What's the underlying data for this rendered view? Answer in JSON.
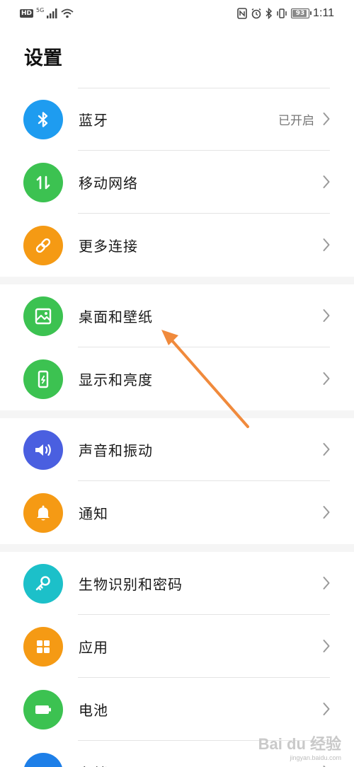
{
  "status_bar": {
    "left_badge": "HD",
    "network": "5G",
    "battery_level": 93,
    "battery_text": "93",
    "time": "1:11",
    "icons": [
      "nfc-icon",
      "alarm-icon",
      "bluetooth-icon",
      "vibrate-icon",
      "battery-icon"
    ]
  },
  "header": {
    "title": "设置"
  },
  "groups": [
    {
      "items": [
        {
          "label": "蓝牙",
          "value": "已开启",
          "icon": "bluetooth-icon",
          "color": "#1e9cf0"
        },
        {
          "label": "移动网络",
          "value": "",
          "icon": "mobile-data-icon",
          "color": "#3cc251"
        },
        {
          "label": "更多连接",
          "value": "",
          "icon": "link-icon",
          "color": "#f59a14"
        }
      ]
    },
    {
      "items": [
        {
          "label": "桌面和壁纸",
          "value": "",
          "icon": "wallpaper-icon",
          "color": "#3cc251"
        },
        {
          "label": "显示和亮度",
          "value": "",
          "icon": "display-icon",
          "color": "#3cc251"
        }
      ]
    },
    {
      "items": [
        {
          "label": "声音和振动",
          "value": "",
          "icon": "sound-icon",
          "color": "#4a5fe0"
        },
        {
          "label": "通知",
          "value": "",
          "icon": "bell-icon",
          "color": "#f59a14"
        }
      ]
    },
    {
      "items": [
        {
          "label": "生物识别和密码",
          "value": "",
          "icon": "key-icon",
          "color": "#1cc0c9"
        },
        {
          "label": "应用",
          "value": "",
          "icon": "apps-icon",
          "color": "#f59a14"
        },
        {
          "label": "电池",
          "value": "",
          "icon": "battery-icon",
          "color": "#3cc251"
        },
        {
          "label": "存储",
          "value": "",
          "icon": "storage-icon",
          "color": "#1e7fe8"
        }
      ]
    }
  ],
  "annotation": {
    "color": "#f08a3c",
    "icon": "arrow-icon"
  },
  "watermark": {
    "logo": "Bai du 经验",
    "url": "jingyan.baidu.com"
  }
}
